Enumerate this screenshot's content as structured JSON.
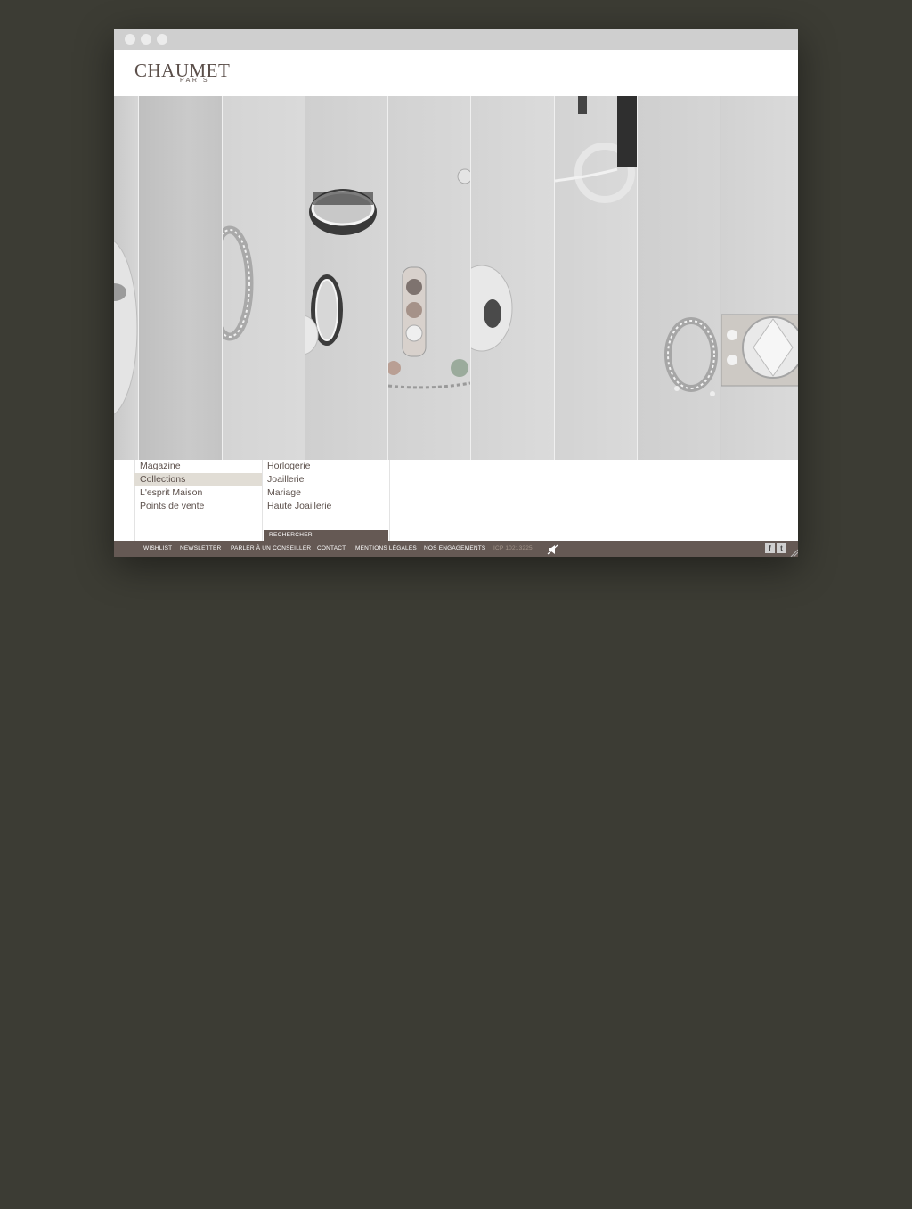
{
  "brand": {
    "name": "CHAUMET",
    "tagline": "PARIS"
  },
  "menu": {
    "primary": [
      {
        "label": "Magazine",
        "active": false
      },
      {
        "label": "Collections",
        "active": true
      },
      {
        "label": "L'esprit Maison",
        "active": false
      },
      {
        "label": "Points de vente",
        "active": false
      }
    ],
    "secondary": [
      {
        "label": "Horlogerie"
      },
      {
        "label": "Joaillerie"
      },
      {
        "label": "Mariage"
      },
      {
        "label": "Haute Joaillerie"
      }
    ],
    "search_label": "RECHERCHER"
  },
  "footer": {
    "links": [
      "WISHLIST",
      "NEWSLETTER",
      "PARLER À UN CONSEILLER",
      "CONTACT",
      "MENTIONS LÉGALES",
      "NOS ENGAGEMENTS"
    ],
    "icp": "ICP 10213225",
    "social": {
      "facebook": "f",
      "twitter": "t"
    }
  },
  "icons": {
    "window_controls": [
      "close-dot",
      "minimize-dot",
      "maximize-dot"
    ],
    "sound": "speaker-mute-icon",
    "resize": "resize-grip-icon"
  },
  "colors": {
    "page_background": "#3c3c34",
    "brand": "#5b4f4a",
    "footer_bar": "#655954",
    "active_item": "#e1ddd5",
    "icp_text": "#a5968c"
  }
}
